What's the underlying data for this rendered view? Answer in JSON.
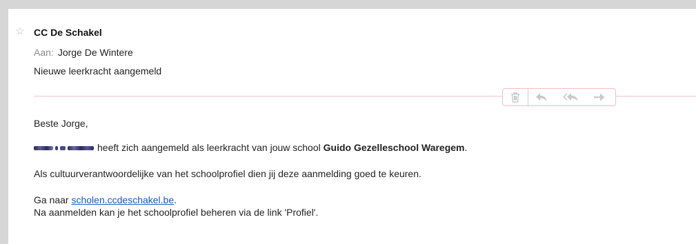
{
  "email": {
    "sender": "CC De Schakel",
    "to_label": "Aan:",
    "to_name": "Jorge De Wintere",
    "subject": "Nieuwe leerkracht aangemeld"
  },
  "toolbar": {
    "icons": [
      "trash-icon",
      "reply-icon",
      "reply-all-icon",
      "forward-icon"
    ]
  },
  "body": {
    "greeting": "Beste Jorge,",
    "line1_text": "heeft zich aangemeld als leerkracht van jouw school",
    "school_name": "Guido Gezelleschool Waregem",
    "line1_end": ".",
    "line2": "Als cultuurverantwoordelijke van het schoolprofiel dien jij deze aanmelding goed te keuren.",
    "line3_prefix": "Ga naar",
    "link": "scholen.ccdeschakel.be",
    "line3_suffix": ".",
    "line4": "Na aanmelden kan je het schoolprofiel beheren via de link 'Profiel'."
  },
  "colors": {
    "frame": "#d6d6d6",
    "divider": "#f0c4cc",
    "link": "#1a57c9",
    "toolbar_icons": "#c9c9c9"
  }
}
